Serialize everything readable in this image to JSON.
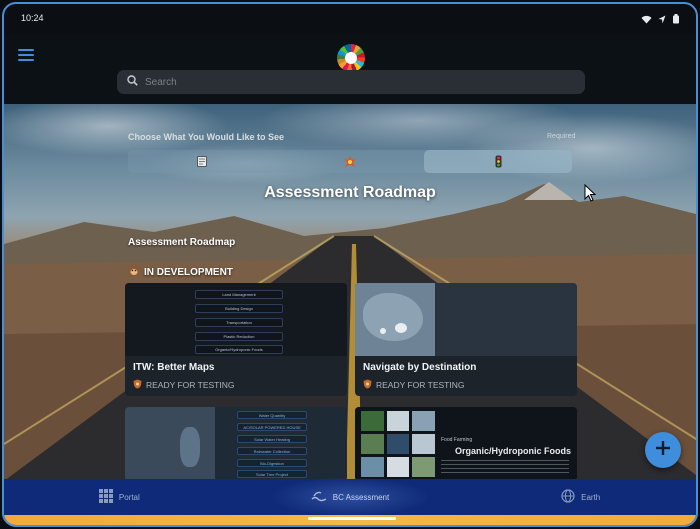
{
  "status_bar": {
    "time": "10:24",
    "icons": [
      "wifi-icon",
      "location-icon",
      "battery-icon"
    ]
  },
  "header": {
    "menu_icon": "hamburger-menu-icon",
    "logo": "sdg-wheel-logo"
  },
  "search": {
    "placeholder": "Search",
    "value": ""
  },
  "filter": {
    "label": "Choose What You Would Like to See",
    "required_label": "Required",
    "options": [
      {
        "icon": "document-icon",
        "selected": false
      },
      {
        "icon": "explosion-icon",
        "selected": false
      },
      {
        "icon": "traffic-light-icon",
        "selected": true
      }
    ]
  },
  "main": {
    "page_title": "Assessment Roadmap",
    "section_title": "Assessment Roadmap",
    "status_heading": "IN DEVELOPMENT",
    "status_heading_icon": "monkey-icon"
  },
  "cards": [
    {
      "title": "ITW: Better Maps",
      "status": "READY FOR TESTING",
      "status_icon": "shield-icon",
      "thumb_items": [
        "Land Management",
        "Building Design",
        "Transportation",
        "Plastic Reduction",
        "Organic/Hydroponic Foods"
      ]
    },
    {
      "title": "Navigate by Destination",
      "status": "READY FOR TESTING",
      "status_icon": "shield-icon"
    },
    {
      "title": "",
      "status": "",
      "thumb_items": [
        "Water Quantity",
        "AC/SOLAR POWERED HOUSE",
        "Solar Water Heating",
        "Rainwater Collection",
        "Bio-Digestion",
        "Solar Tree Project"
      ]
    },
    {
      "title": "",
      "status": "",
      "thumb_heading": "Organic/Hydroponic Foods",
      "thumb_subheading": "Food Farming"
    }
  ],
  "fab": {
    "icon": "plus-icon"
  },
  "tabbar": {
    "tabs": [
      {
        "label": "Portal",
        "icon": "grid-icon",
        "active": false
      },
      {
        "label": "BC Assessment",
        "icon": "waves-icon",
        "active": true
      },
      {
        "label": "Earth",
        "icon": "globe-icon",
        "active": false
      }
    ]
  },
  "colors": {
    "accent": "#3f8ddd",
    "tabbar": "#0f2a78",
    "card": "#1d232b",
    "frame_border": "#4a8fd6",
    "bottom_strip": "#f2a93b"
  }
}
